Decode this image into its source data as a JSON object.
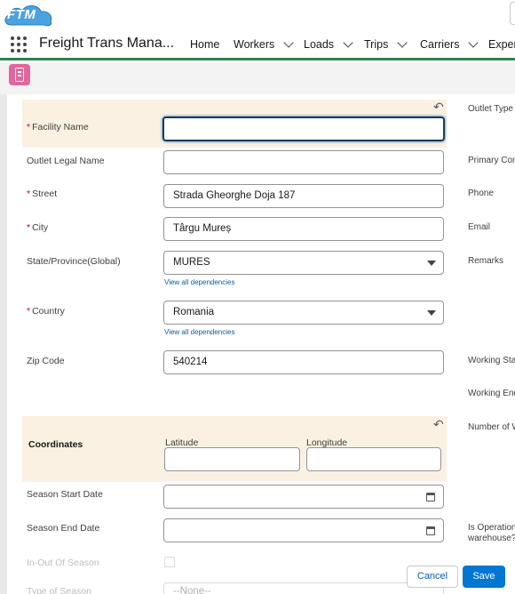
{
  "app": {
    "logo_text": "FTM",
    "name": "Freight Trans Mana...",
    "nav": [
      {
        "label": "Home",
        "has_menu": false
      },
      {
        "label": "Workers",
        "has_menu": true
      },
      {
        "label": "Loads",
        "has_menu": true
      },
      {
        "label": "Trips",
        "has_menu": true
      },
      {
        "label": "Carriers",
        "has_menu": true
      },
      {
        "label": "Expens",
        "has_menu": false
      }
    ]
  },
  "form": {
    "facility_name": {
      "label": "Facility Name",
      "required": true,
      "value": ""
    },
    "outlet_legal_name": {
      "label": "Outlet Legal Name",
      "value": ""
    },
    "street": {
      "label": "Street",
      "required": true,
      "value": "Strada Gheorghe Doja 187"
    },
    "city": {
      "label": "City",
      "required": true,
      "value": "Târgu Mureș"
    },
    "state": {
      "label": "State/Province(Global)",
      "value": "MURES",
      "link": "View all dependencies"
    },
    "country": {
      "label": "Country",
      "required": true,
      "value": "Romania",
      "link": "View all dependencies"
    },
    "zip": {
      "label": "Zip Code",
      "value": "540214"
    },
    "coordinates": {
      "label": "Coordinates",
      "latitude_label": "Latitude",
      "longitude_label": "Longitude",
      "latitude": "",
      "longitude": ""
    },
    "season_start": {
      "label": "Season Start Date",
      "value": ""
    },
    "season_end": {
      "label": "Season End Date",
      "value": ""
    },
    "in_out_season": {
      "label": "In-Out Of Season"
    },
    "type_of_season": {
      "label": "Type of Season",
      "value": "--None--"
    }
  },
  "right_column": [
    "Outlet Type",
    "Primary Con",
    "Phone",
    "Email",
    "Remarks",
    "Working Sta",
    "Working End",
    "Number of W",
    "Is Operation",
    "warehouse?"
  ],
  "footer": {
    "cancel": "Cancel",
    "save": "Save"
  },
  "colors": {
    "accent": "#0176d3",
    "nav_underline": "#2e844a",
    "highlight": "#faf1e2",
    "object_icon": "#e3669a"
  },
  "icons": {
    "undo": "undo-icon",
    "calendar": "calendar-icon",
    "dropdown": "chevron-down-icon",
    "apps": "app-launcher-icon",
    "object": "building-icon"
  }
}
